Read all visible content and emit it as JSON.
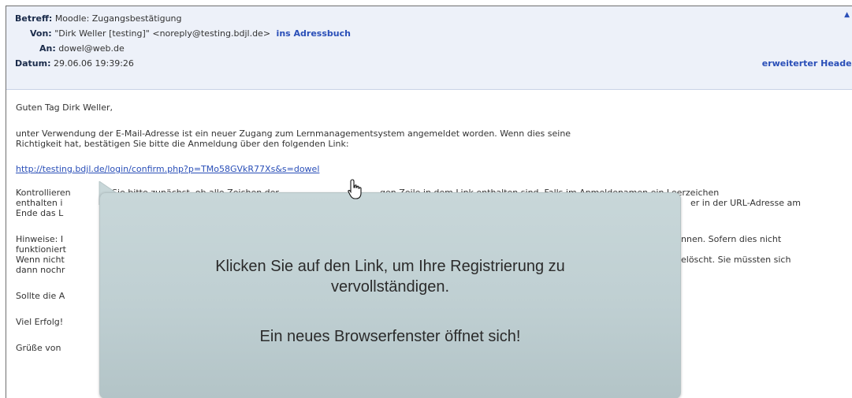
{
  "header": {
    "subject_label": "Betreff:",
    "subject_value": "Moodle: Zugangsbestätigung",
    "from_label": "Von:",
    "from_value": "\"Dirk Weller [testing]\" <noreply@testing.bdjl.de>",
    "add_to_addressbook": "ins Adressbuch",
    "to_label": "An:",
    "to_value": "dowel@web.de",
    "date_label": "Datum:",
    "date_value": "29.06.06 19:39:26",
    "extended_header_link": "erweiterter Header"
  },
  "body": {
    "greeting": "Guten Tag Dirk Weller,",
    "para1_line1": "unter Verwendung der E-Mail-Adresse ist ein neuer Zugang zum Lernmanagementsystem angemeldet worden. Wenn dies seine",
    "para1_line2": "Richtigkeit hat, bestätigen Sie bitte die Anmeldung über den folgenden Link:",
    "confirm_link": "http://testing.bdjl.de/login/confirm.php?p=TMo58GVkR77Xs&s=dowel",
    "para2_left1": "Kontrollieren",
    "para2_mid1": "Sie bitte zunächst, ob alle Zeichen der",
    "para2_right1": "gen Zeile in dem Link enthalten sind. Falls im Anmeldenamen ein Leerzeichen",
    "para2_left2": "enthalten i",
    "para2_right2": "er in der URL-Adresse am",
    "para2_left3": "Ende das L",
    "para3_left1": "Hinweise: I",
    "para3_right1": "nnen. Sofern dies nicht",
    "para3_left2": "funktioniert",
    "para3_left3": "Wenn nicht",
    "para3_right3": "elöscht. Sie müssten sich",
    "para3_left4": "dann nochr",
    "para4_left": "Sollte die A",
    "para5_left": "Viel Erfolg!",
    "para6_left": "Grüße von"
  },
  "callout": {
    "line1": "Klicken Sie auf den Link, um Ihre Registrierung zu",
    "line2": "vervollständigen.",
    "line3": "Ein neues Browserfenster öffnet sich!"
  },
  "colors": {
    "header_bg": "#edf1f9",
    "link": "#2a4fb8",
    "callout_bg": "#c2d2d5"
  },
  "icons": {
    "cursor": "hand-pointer-icon",
    "scroll": "scroll-up-arrow-icon"
  }
}
